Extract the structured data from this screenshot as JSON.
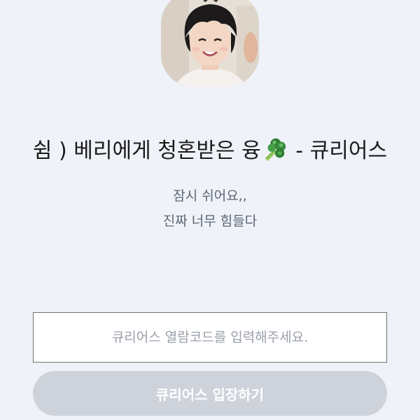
{
  "header": {
    "title_prefix": "쉼 ) 베리에게 청혼받은 융",
    "title_suffix": " - 큐리어스",
    "title_emoji_icon": "broccoli-icon"
  },
  "message": {
    "line1": "잠시 쉬어요,,",
    "line2": "진짜 너무 힘들다"
  },
  "entry": {
    "code_placeholder": "큐리어스 열람코드를 입력해주세요.",
    "code_value": "",
    "enter_button_label": "큐리어스 입장하기"
  },
  "colors": {
    "background": "#eff2f8",
    "button_disabled": "#cdd2db",
    "message_text": "#5d6675",
    "input_border": "#707070"
  }
}
